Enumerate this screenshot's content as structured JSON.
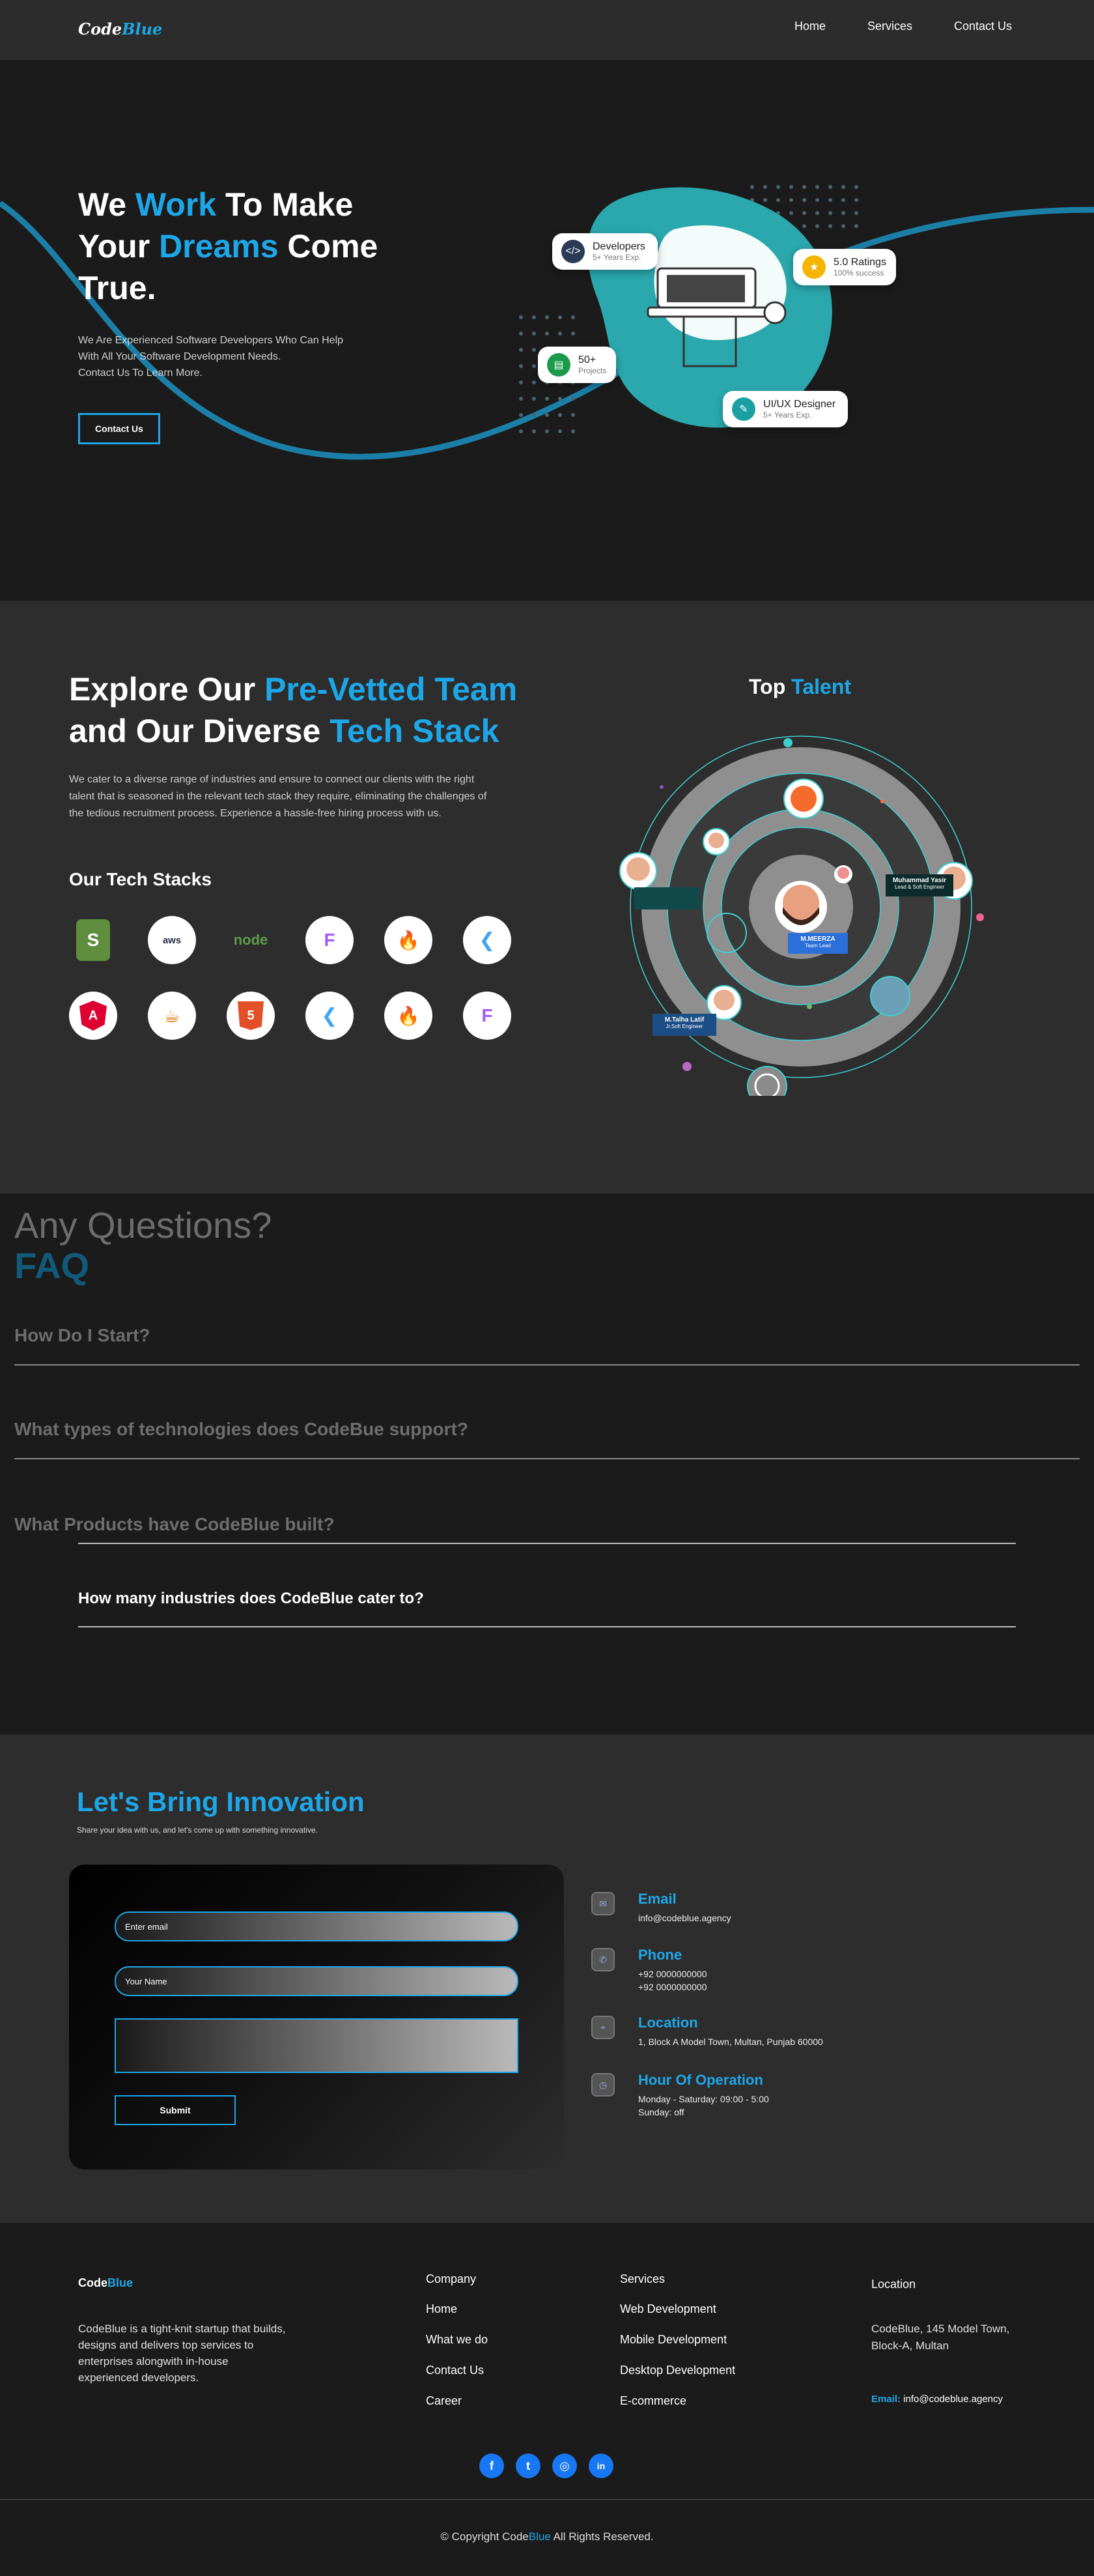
{
  "header": {
    "logo_a": "Code",
    "logo_b": "Blue",
    "nav": [
      "Home",
      "Services",
      "Contact Us"
    ]
  },
  "hero": {
    "l1a": "We ",
    "l1b": "Work",
    "l1c": " To Make",
    "l2a": "Your ",
    "l2b": "Dreams",
    "l2c": " Come",
    "l3": "True.",
    "sub": [
      "We Are Experienced Software Developers Who Can Help",
      "With All Your Software Development Needs.",
      "Contact Us To Learn More."
    ],
    "cta": "Contact Us",
    "badges": [
      {
        "title": "Developers",
        "sub": "5+ Years Exp.",
        "icon": "code-icon"
      },
      {
        "title": "5.0 Ratings",
        "sub": "100% success",
        "icon": "star-icon"
      },
      {
        "title": "50+",
        "sub": "Projects",
        "icon": "project-icon"
      },
      {
        "title": "UI/UX Designer",
        "sub": "5+ Years Exp.",
        "icon": "design-icon"
      }
    ]
  },
  "team": {
    "l1a": "Explore Our ",
    "l1b": "Pre-Vetted Team",
    "l2a": "and Our Diverse ",
    "l2b": "Tech Stack",
    "desc": [
      "We cater to a diverse range of industries and ensure to connect our clients with the right",
      "talent that is seasoned in the relevant tech stack they require, eliminating the challenges of",
      "the tedious recruitment process. Experience a hassle-free hiring process with us."
    ],
    "stacks_title": "Our Tech Stacks",
    "stacks": [
      "S",
      "aws",
      "node",
      "F",
      "🔥",
      "❮",
      "A",
      "☕",
      "5",
      "❮",
      "🔥",
      "F"
    ],
    "top_a": "Top ",
    "top_b": "Talent",
    "talent": [
      {
        "name": "M.MEERZA",
        "role": "Team Lead"
      },
      {
        "name": "Muhammad Yasir",
        "role": "Lead & Soft Engineer"
      },
      {
        "name": "M.Talha Latif",
        "role": "Jr.Soft Engineer"
      }
    ]
  },
  "faq": {
    "pre": "Any Questions?",
    "title": "FAQ",
    "items": [
      "How Do I Start?",
      "What types of technologies does CodeBue support?",
      "What Products have CodeBlue built?",
      "How many industries does CodeBlue cater to?"
    ]
  },
  "contact": {
    "title": "Let's Bring Innovation",
    "sub": "Share your idea with us, and let's come up with something innovative.",
    "email_ph": "Enter email",
    "name_ph": "Your Name",
    "submit": "Submit",
    "info": [
      {
        "title": "Email",
        "lines": [
          "info@codeblue.agency"
        ]
      },
      {
        "title": "Phone",
        "lines": [
          "+92 0000000000",
          "+92 0000000000"
        ]
      },
      {
        "title": "Location",
        "lines": [
          "1, Block A Model Town, Multan, Punjab 60000"
        ]
      },
      {
        "title": "Hour Of Operation",
        "lines": [
          "Monday - Saturday: 09:00 - 5:00",
          "Sunday: off"
        ]
      }
    ]
  },
  "footer": {
    "logo_a": "Code",
    "logo_b": "Blue",
    "about": [
      "CodeBlue is a tight-knit startup that builds,",
      "designs and delivers top services to",
      "enterprises alongwith in-house",
      "experienced developers."
    ],
    "company": [
      "Company",
      "Home",
      "What we do",
      "Contact Us",
      "Career"
    ],
    "services": [
      "Services",
      "Web Development",
      "Mobile Development",
      "Desktop Development",
      "E-commerce"
    ],
    "loc_title": "Location",
    "loc": [
      "CodeBlue, 145 Model Town,",
      "Block-A, Multan"
    ],
    "email_label": "Email:",
    "email": " info@codeblue.agency",
    "social": [
      "f",
      "t",
      "◎",
      "in"
    ],
    "copy_a": "© Copyright Code",
    "copy_b": "Blue",
    "copy_c": " All Rights Reserved."
  }
}
